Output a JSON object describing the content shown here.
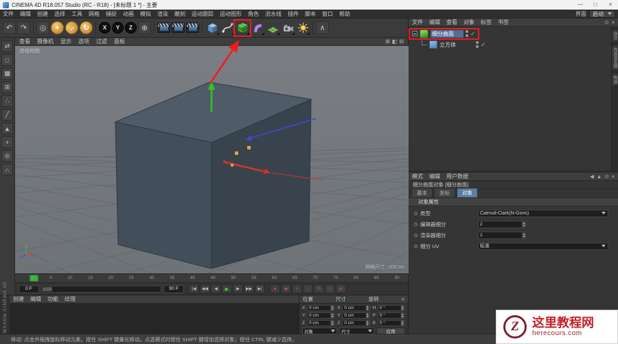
{
  "window": {
    "title": "CINEMA 4D R18.057 Studio (RC - R18) - [未标题 1 *] - 主要",
    "minimize_glyph": "—",
    "maximize_glyph": "□",
    "close_glyph": "×"
  },
  "menubar": {
    "items": [
      "文件",
      "编辑",
      "创建",
      "选择",
      "工具",
      "网格",
      "捕捉",
      "动画",
      "模拟",
      "渲染",
      "雕刻",
      "运动跟踪",
      "运动图形",
      "角色",
      "流水线",
      "插件",
      "脚本",
      "窗口",
      "帮助"
    ],
    "interface_label": "界面",
    "interface_value": "启动"
  },
  "icons": {
    "menu": "≡"
  },
  "toolbar": {
    "undo": "↶",
    "redo": "↷",
    "live_selection": "◎",
    "move": "+",
    "scale": "↔",
    "rotate": "↻",
    "axis_x": "X",
    "axis_y": "Y",
    "axis_z": "Z",
    "coord": "⊕",
    "more": "∧",
    "icon_names": [
      "undo",
      "redo",
      "live-selection",
      "move-tool",
      "scale-tool",
      "rotate-tool",
      "lock-x-axis",
      "lock-y-axis",
      "lock-z-axis",
      "coordinate-system",
      "render-view",
      "render-picture-viewer",
      "render-settings",
      "cube-primitive",
      "spline-pen",
      "subdivision-surface",
      "bend-deformer",
      "floor",
      "camera",
      "light"
    ]
  },
  "left_tools": [
    {
      "name": "convert-object-icon",
      "glyph": "⇄"
    },
    {
      "name": "model-mode-icon",
      "glyph": "□"
    },
    {
      "name": "texture-mode-icon",
      "glyph": "▩"
    },
    {
      "name": "workplane-mode-icon",
      "glyph": "⊞"
    },
    {
      "name": "points-mode-icon",
      "glyph": "∴"
    },
    {
      "name": "edges-mode-icon",
      "glyph": "╱"
    },
    {
      "name": "polygons-mode-icon",
      "glyph": "▲"
    },
    {
      "name": "enable-axis-icon",
      "glyph": "+"
    },
    {
      "name": "viewport-solo-icon",
      "glyph": "◎"
    },
    {
      "name": "snap-icon",
      "glyph": "∩"
    }
  ],
  "viewport": {
    "menus": [
      "查看",
      "摄像机",
      "显示",
      "选项",
      "过滤",
      "面板"
    ],
    "window_icons": [
      {
        "name": "toggle-active-view-icon",
        "glyph": "⊞"
      },
      {
        "name": "single-view-icon",
        "glyph": "◧"
      },
      {
        "name": "quad-view-icon",
        "glyph": "⊟"
      }
    ],
    "view_label": "透视视图",
    "grid_label": "网格尺寸 : 100 cm"
  },
  "timeline": {
    "ticks": [
      "0",
      "5",
      "10",
      "15",
      "20",
      "25",
      "30",
      "35",
      "40",
      "45",
      "50",
      "55",
      "60",
      "65",
      "70",
      "75",
      "80",
      "85",
      "90"
    ],
    "current_frame": "0 F",
    "end_frame": "90 F",
    "goto_start": "|◀",
    "prev_key": "◀◀",
    "prev_frame": "◀",
    "play": "▶",
    "next_frame": "▶",
    "next_key": "▶▶",
    "goto_end": "▶|",
    "record": "●",
    "autokey": "◉",
    "key_position": "+",
    "key_scale": "↔",
    "key_rotation": "↻",
    "key_parameter": "◇",
    "playback_mode": "⇄"
  },
  "materials_panel": {
    "menus": [
      "创建",
      "编辑",
      "功能",
      "纹理"
    ]
  },
  "coordinates": {
    "groups": [
      {
        "title": "位置",
        "rows": [
          {
            "axis": "X",
            "value": "0 cm"
          },
          {
            "axis": "Y",
            "value": "0 cm"
          },
          {
            "axis": "Z",
            "value": "0 cm"
          }
        ]
      },
      {
        "title": "尺寸",
        "rows": [
          {
            "axis": "X",
            "value": "0 cm"
          },
          {
            "axis": "Y",
            "value": "0 cm"
          },
          {
            "axis": "Z",
            "value": "0 cm"
          }
        ]
      },
      {
        "title": "旋转",
        "rows": [
          {
            "axis": "H",
            "value": "0 °"
          },
          {
            "axis": "P",
            "value": "0 °"
          },
          {
            "axis": "B",
            "value": "0 °"
          }
        ]
      }
    ],
    "system_dropdown": "对象",
    "size_dropdown": "尺寸",
    "apply_button": "应用"
  },
  "object_manager": {
    "menus": [
      "文件",
      "编辑",
      "查看",
      "对象",
      "标签",
      "书签"
    ],
    "window_icons": [
      {
        "name": "find-icon",
        "glyph": "⊙"
      },
      {
        "name": "panel-menu-icon",
        "glyph": "≡"
      }
    ],
    "objects": [
      {
        "name": "细分曲面",
        "check": "✓"
      },
      {
        "name": "立方体",
        "check": "✓"
      }
    ],
    "right_tabs": [
      "场次",
      "内容浏览器",
      "构造"
    ]
  },
  "attribute_manager": {
    "menus": [
      "模式",
      "编辑",
      "用户数据"
    ],
    "window_icons": [
      {
        "name": "history-back-icon",
        "glyph": "◀"
      },
      {
        "name": "history-up-icon",
        "glyph": "▲"
      },
      {
        "name": "lock-icon",
        "glyph": "⊙"
      },
      {
        "name": "panel-menu-icon",
        "glyph": "≡"
      }
    ],
    "title": "细分曲面对象 [细分曲面]",
    "tabs": [
      "基本",
      "坐标",
      "对象"
    ],
    "active_tab": "对象",
    "section": "对象属性",
    "fields": [
      {
        "label": "类型",
        "value": "Catmull-Clark(N-Gons)",
        "type": "dropdown"
      },
      {
        "label": "编辑器细分",
        "value": "2",
        "type": "number"
      },
      {
        "label": "渲染器细分",
        "value": "2",
        "type": "number"
      },
      {
        "label": "细分 UV",
        "value": "标准",
        "type": "dropdown"
      }
    ]
  },
  "statusbar": {
    "text": "移动: 点击并拖拽鼠标移动元素。按住 SHIFT 键量化移动。点选模式时按住 SHIFT 键增加选择对象；按住 CTRL 键减少选择。"
  },
  "branding": {
    "vertical_text": "MAXON  CINEMA 4D"
  },
  "watermark": {
    "logo_letter": "Z",
    "site_name": "这里教程网",
    "site_url": "herecours.com",
    "accent_color": "#c32026"
  },
  "annotations": {
    "color": "#ec1c24"
  }
}
